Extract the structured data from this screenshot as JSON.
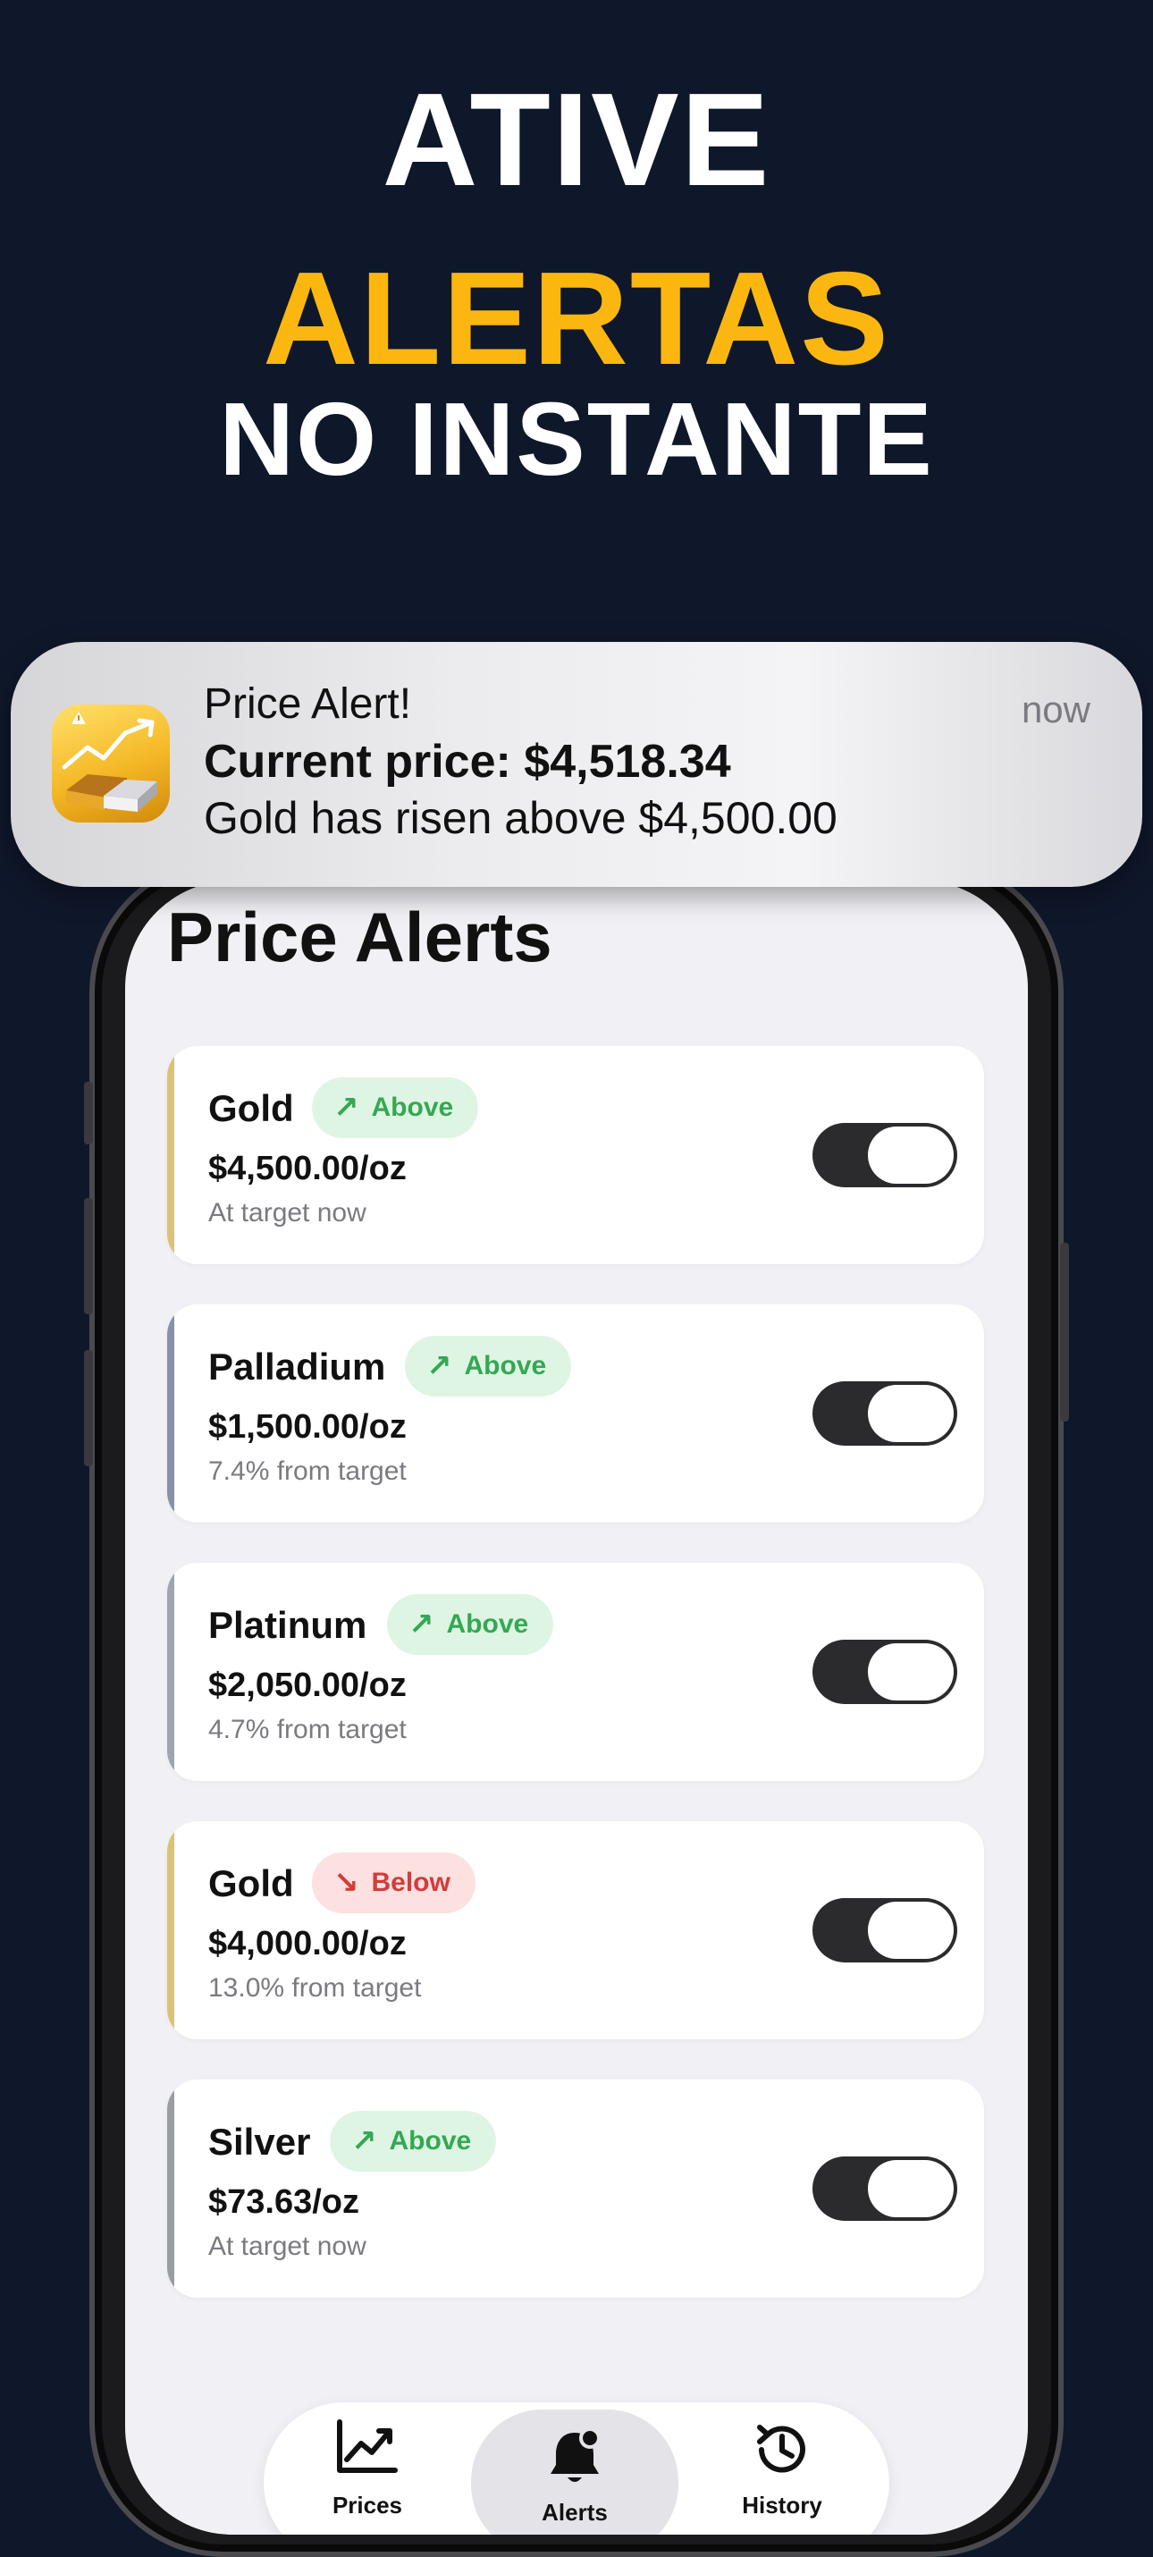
{
  "headline": {
    "line1": "ATIVE",
    "line2": "ALERTAS",
    "line3": "NO INSTANTE"
  },
  "notification": {
    "title": "Price Alert!",
    "line1": "Current price: $4,518.34",
    "line2": "Gold has risen above $4,500.00",
    "time": "now",
    "icon": "gold-bars-chart-icon"
  },
  "screen": {
    "title": "Price Alerts"
  },
  "alerts": [
    {
      "metal": "Gold",
      "direction": "Above",
      "arrow": "↗",
      "price": "$4,500.00/oz",
      "status": "At target now",
      "enabled": true,
      "accent_color": "#d9c27a"
    },
    {
      "metal": "Palladium",
      "direction": "Above",
      "arrow": "↗",
      "price": "$1,500.00/oz",
      "status": "7.4% from target",
      "enabled": true,
      "accent_color": "#8890a8"
    },
    {
      "metal": "Platinum",
      "direction": "Above",
      "arrow": "↗",
      "price": "$2,050.00/oz",
      "status": "4.7% from target",
      "enabled": true,
      "accent_color": "#a0a4ae"
    },
    {
      "metal": "Gold",
      "direction": "Below",
      "arrow": "↘",
      "price": "$4,000.00/oz",
      "status": "13.0% from target",
      "enabled": true,
      "accent_color": "#d9c27a"
    },
    {
      "metal": "Silver",
      "direction": "Above",
      "arrow": "↗",
      "price": "$73.63/oz",
      "status": "At target now",
      "enabled": true,
      "accent_color": "#9a9ca4"
    }
  ],
  "tabbar": {
    "tabs": [
      {
        "label": "Prices",
        "icon": "chart-line-icon",
        "active": false
      },
      {
        "label": "Alerts",
        "icon": "bell-icon",
        "active": true
      },
      {
        "label": "History",
        "icon": "history-clock-icon",
        "active": false
      }
    ]
  },
  "colors": {
    "background": "#0f172a",
    "accent_yellow": "#fbb70f",
    "above_green": "#34a853",
    "below_red": "#d23c3c",
    "toggle_on": "#2b2b2e"
  }
}
